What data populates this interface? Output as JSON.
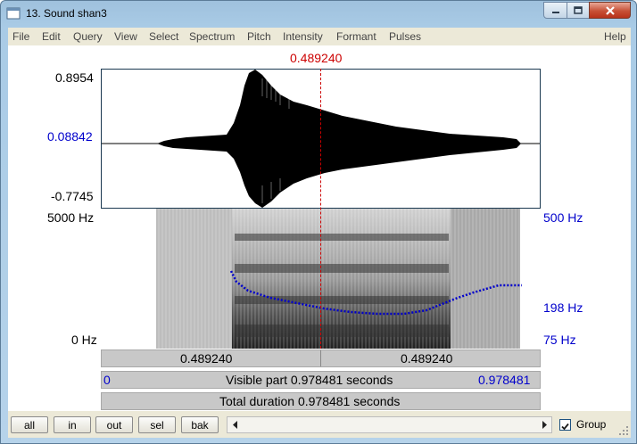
{
  "window": {
    "title": "13. Sound shan3",
    "icon": "app-icon"
  },
  "menu": [
    "File",
    "Edit",
    "Query",
    "View",
    "Select",
    "Spectrum",
    "Pitch",
    "Intensity",
    "Formant",
    "Pulses",
    "Help"
  ],
  "cursor": {
    "time_label": "0.489240",
    "color": "#cc0000"
  },
  "waveform": {
    "max_label": "0.8954",
    "cursor_value_label": "0.08842",
    "min_label": "-0.7745"
  },
  "spectrogram": {
    "top_label": "5000 Hz",
    "bottom_label": "0 Hz"
  },
  "pitch": {
    "top_label": "500 Hz",
    "cursor_label": "198 Hz",
    "bottom_label": "75 Hz",
    "color": "#0000cc"
  },
  "selection_bar": {
    "left_label": "0.489240",
    "right_label": "0.489240"
  },
  "visible_bar": {
    "start_label": "0",
    "text": "Visible part 0.978481 seconds",
    "end_label": "0.978481"
  },
  "total_bar": {
    "text": "Total duration 0.978481 seconds"
  },
  "nav_buttons": [
    "all",
    "in",
    "out",
    "sel",
    "bak"
  ],
  "group": {
    "label": "Group",
    "checked": true
  }
}
